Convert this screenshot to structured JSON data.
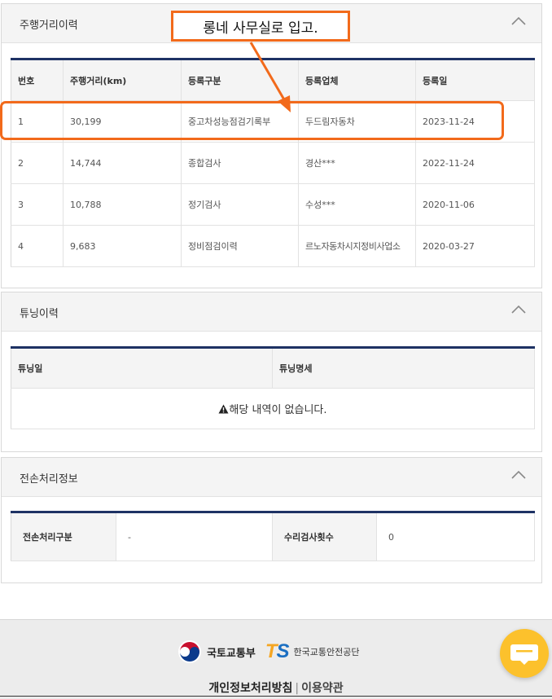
{
  "mileage": {
    "title": "주행거리이력",
    "headers": [
      "번호",
      "주행거리(km)",
      "등록구분",
      "등록업체",
      "등록일"
    ],
    "rows": [
      [
        "1",
        "30,199",
        "중고차성능점검기록부",
        "두드림자동차",
        "2023-11-24"
      ],
      [
        "2",
        "14,744",
        "종합검사",
        "경산***",
        "2022-11-24"
      ],
      [
        "3",
        "10,788",
        "정기검사",
        "수성***",
        "2020-11-06"
      ],
      [
        "4",
        "9,683",
        "정비점검이력",
        "르노자동차시지정비사업소",
        "2020-03-27"
      ]
    ]
  },
  "annotation": {
    "callout_text": "롱네 사무실로 입고.",
    "color": "#f26a1b"
  },
  "tuning": {
    "title": "튜닝이력",
    "headers": [
      "튜닝일",
      "튜닝명세"
    ],
    "empty_text": "해당 내역이 없습니다.",
    "empty_icon": "warning-icon"
  },
  "total_loss": {
    "title": "전손처리정보",
    "label1": "전손처리구분",
    "value1": "-",
    "label2": "수리검사횟수",
    "value2": "0"
  },
  "footer": {
    "ministry": "국토교통부",
    "ts_t": "T",
    "ts_s": "S",
    "kotsa": "한국교통안전공단",
    "privacy": "개인정보처리방침",
    "separator": "|",
    "terms": "이용약관"
  },
  "colors": {
    "table_accent": "#1e3264",
    "chat_button": "#fcc12c"
  }
}
